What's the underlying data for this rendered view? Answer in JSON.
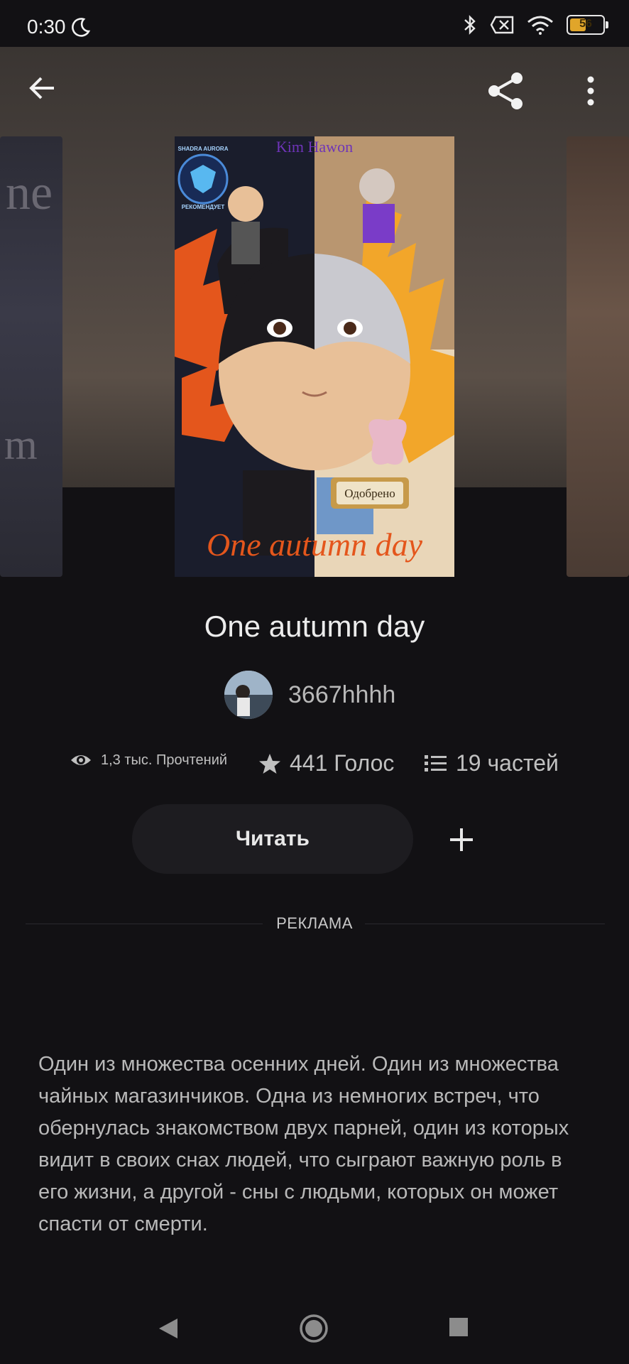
{
  "status_bar": {
    "time": "0:30",
    "battery": "56",
    "battery_level": 0.56,
    "icons": [
      "moon-icon",
      "bluetooth-icon",
      "no-sim-icon",
      "wifi-icon",
      "battery-icon"
    ]
  },
  "toolbar": {
    "icons": [
      "back-arrow-icon",
      "share-icon",
      "more-vert-icon"
    ]
  },
  "cover": {
    "cover_title": "One autumn day",
    "top_label": "Kim Hawon",
    "stamp": "Одобрено",
    "badge_lines": [
      "SHADRA AURORA",
      "РЕКОМЕНДУЕТ"
    ]
  },
  "story": {
    "title": "One autumn day",
    "author": "3667hhhh",
    "reads": "1,3 тыс. Прочтений",
    "votes": "441 Голос",
    "parts": "19 частей",
    "description": "Один из множества осенних дней. Один из множества чайных магазинчиков. Одна из немногих встреч, что обернулась знакомством двух парней, один из которых видит в своих снах людей, что сыграют важную роль в его жизни, а другой - сны с людьми, которых он может спасти от смерти."
  },
  "actions": {
    "read_label": "Читать"
  },
  "ad": {
    "label": "РЕКЛАМА"
  },
  "colors": {
    "background": "#121114",
    "button": "#1d1c20",
    "battery": "#e0a52a",
    "cover_orange": "#e4561c"
  }
}
